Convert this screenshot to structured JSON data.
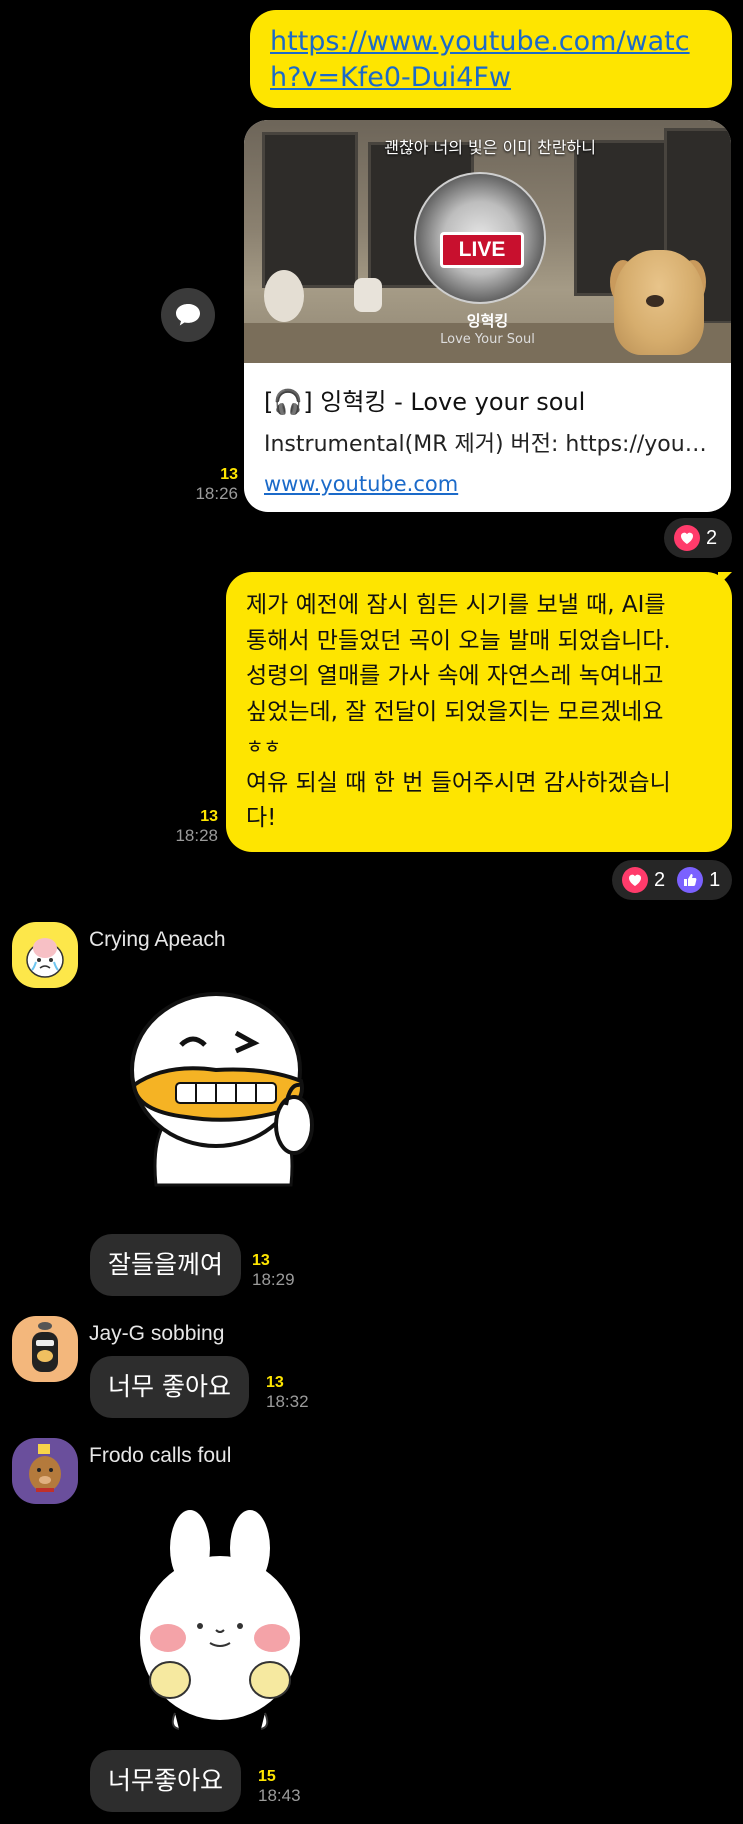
{
  "messages": {
    "link": {
      "url": "https://www.youtube.com/watch?v=Kfe0-Dui4Fw",
      "card_caption": "괜찮아 너의 빛은 이미 찬란하니",
      "card_badge": "LIVE",
      "card_artist": "잉혁킹",
      "card_song": "Love Your Soul",
      "card_title": "[🎧] 잉혁킹 - Love your soul",
      "card_desc": "Instrumental(MR 제거) 버전: https://youtu...",
      "card_domain": "www.youtube.com",
      "count": "13",
      "time": "18:26",
      "reactions": [
        {
          "icon": "heart-icon",
          "count": "2"
        }
      ]
    },
    "long": {
      "lines": [
        "제가 예전에 잠시 힘든 시기를 보낼 때, AI를",
        "통해서 만들었던 곡이 오늘 발매 되었습니다.",
        "성령의 열매를 가사 속에 자연스레 녹여내고",
        "싶었는데, 잘 전달이 되었을지는 모르겠네요",
        "ㅎㅎ",
        "여유 되실 때 한 번 들어주시면 감사하겠습니",
        "다!"
      ],
      "count": "13",
      "time": "18:28",
      "reactions": [
        {
          "icon": "heart-icon",
          "count": "2"
        },
        {
          "icon": "thumbs-up-icon",
          "count": "1"
        }
      ]
    },
    "apeach": {
      "sender": "Crying Apeach",
      "text": "잘들을께여",
      "count": "13",
      "time": "18:29"
    },
    "jayg": {
      "sender": "Jay-G sobbing",
      "text": "너무 좋아요",
      "count": "13",
      "time": "18:32"
    },
    "frodo": {
      "sender": "Frodo calls foul",
      "text": "너무좋아요",
      "count": "15",
      "time": "18:43"
    }
  },
  "colors": {
    "sent_bubble": "#fee500",
    "received_bubble": "#2d2d2d",
    "unread_count": "#fee500",
    "link": "#1b6ac9"
  }
}
